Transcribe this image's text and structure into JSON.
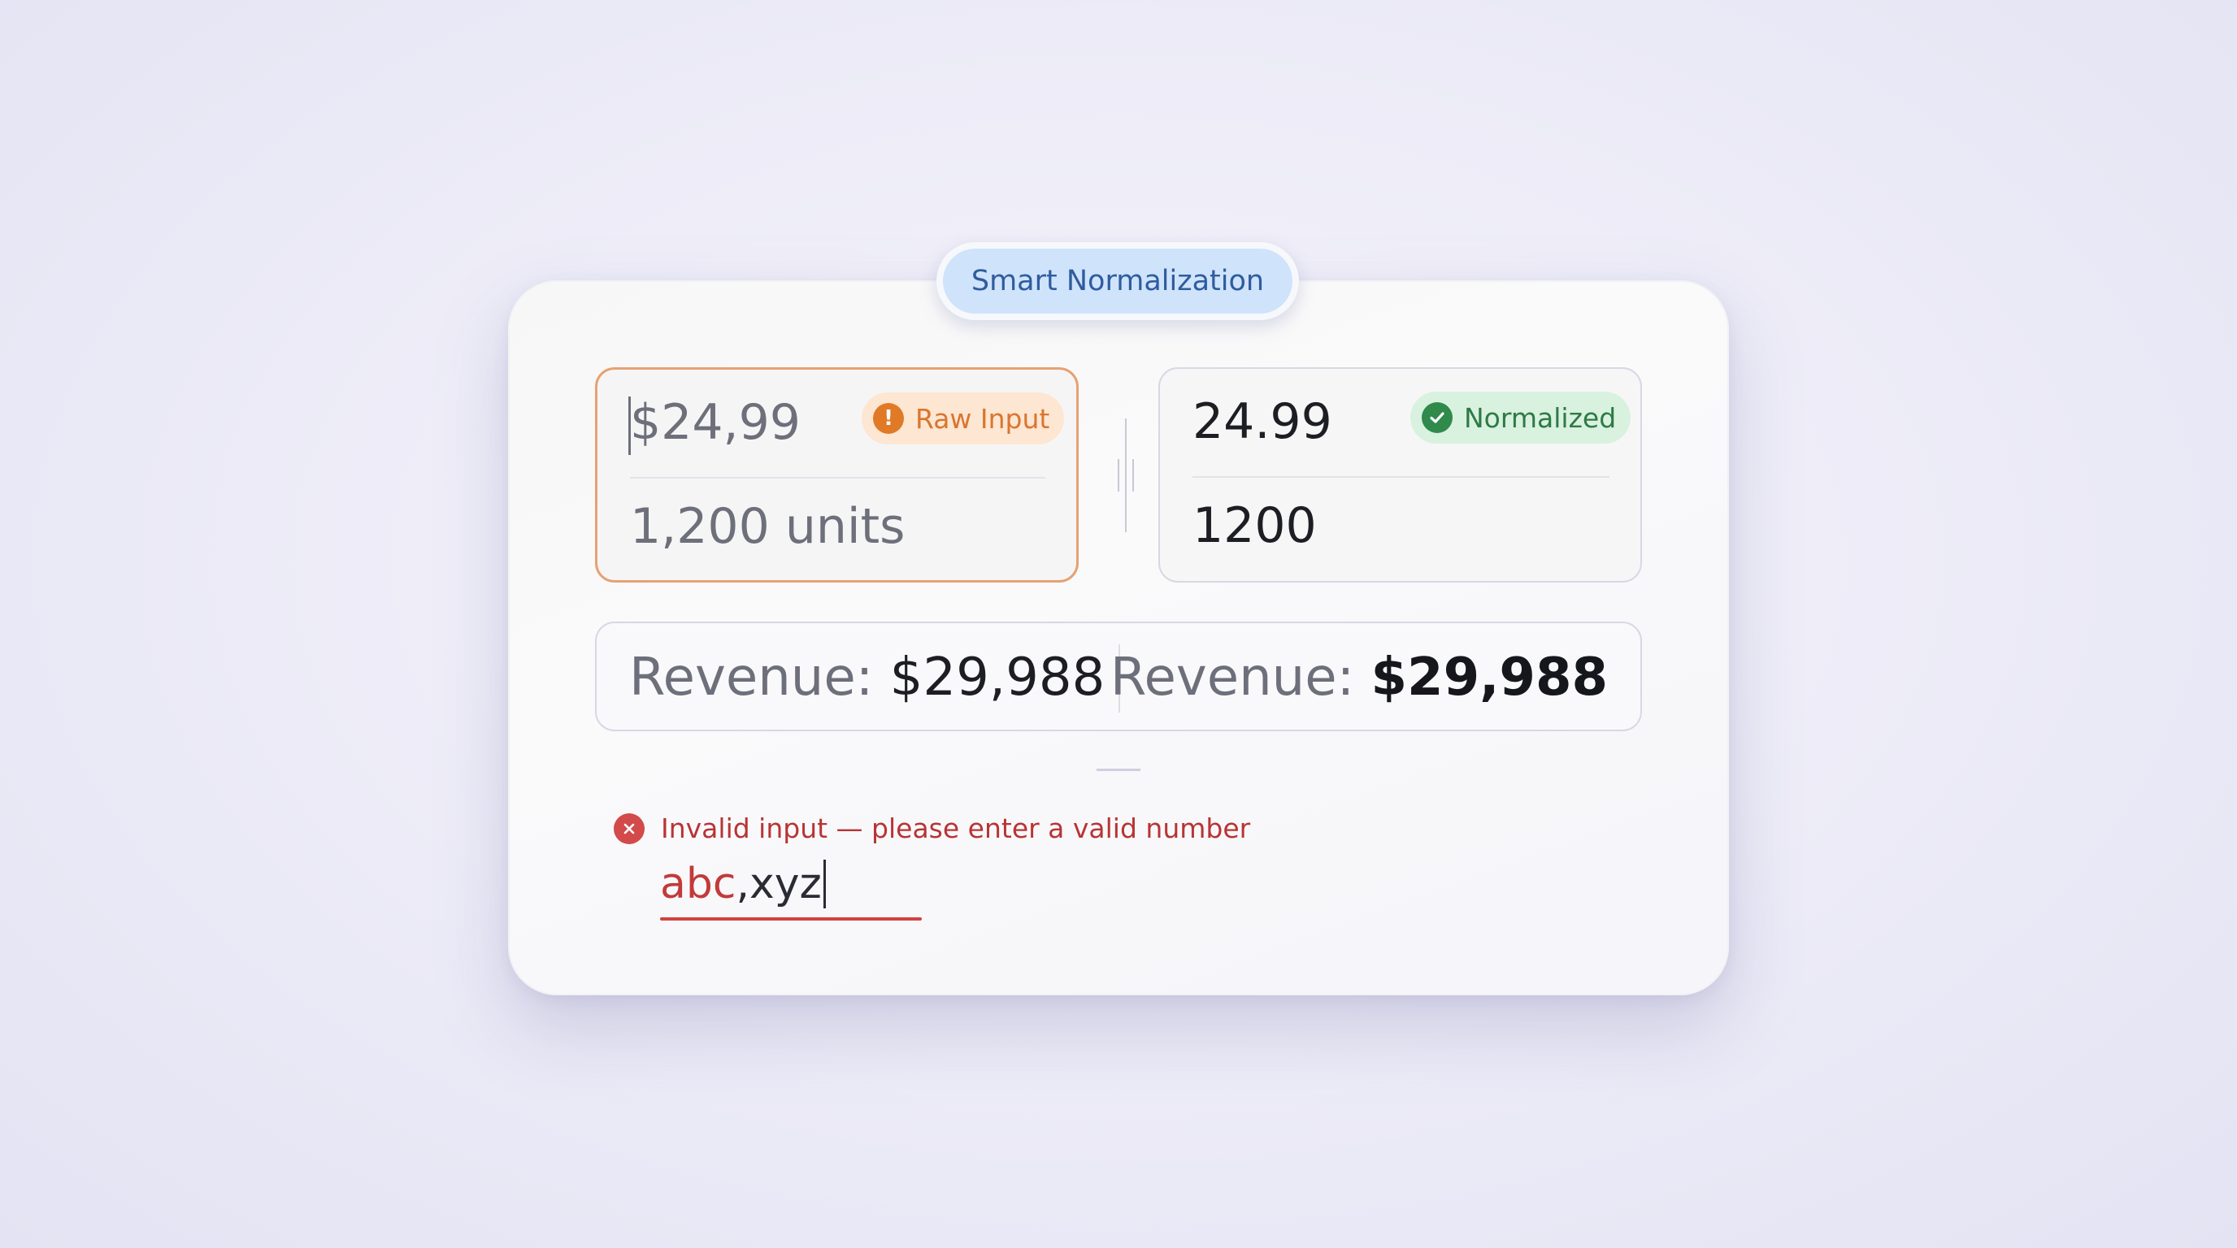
{
  "header": {
    "title": "Smart Normalization"
  },
  "raw": {
    "badge": "Raw Input",
    "badge_icon": "exclamation-icon",
    "price": "$24,99",
    "units": "1,200 units"
  },
  "normalized": {
    "badge": "Normalized",
    "badge_icon": "check-icon",
    "price": "24.99",
    "units": "1200"
  },
  "revenue": {
    "label": "Revenue:",
    "raw_value": "$29,988",
    "normalized_value": "$29,988"
  },
  "error": {
    "icon": "close-icon",
    "message": "Invalid input — please enter a valid number",
    "input_invalid_part": "abc",
    "input_rest": ",xyz"
  },
  "colors": {
    "raw_accent": "#e07a26",
    "normalized_accent": "#2f8a4c",
    "error": "#d24a4a",
    "header_pill": "#cfe3fb"
  }
}
